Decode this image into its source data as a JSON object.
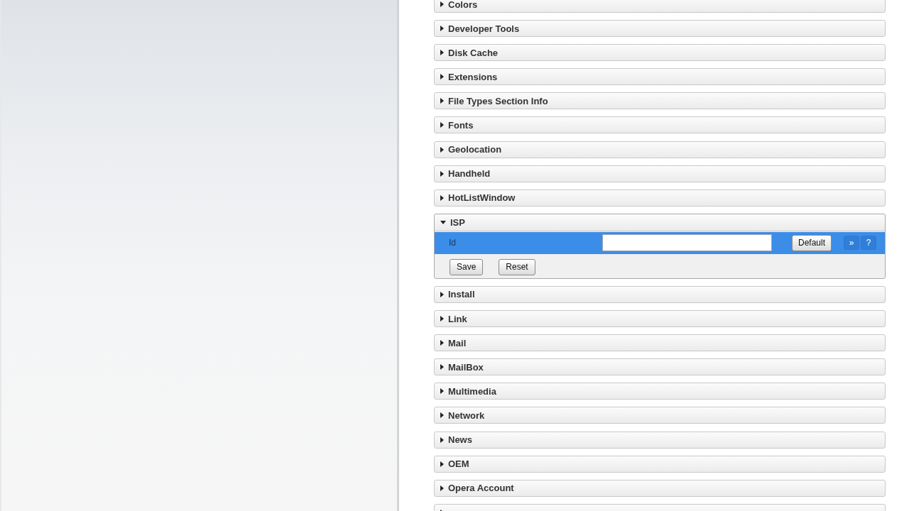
{
  "sections": [
    {
      "title": "Colors",
      "expanded": false
    },
    {
      "title": "Developer Tools",
      "expanded": false
    },
    {
      "title": "Disk Cache",
      "expanded": false
    },
    {
      "title": "Extensions",
      "expanded": false
    },
    {
      "title": "File Types Section Info",
      "expanded": false
    },
    {
      "title": "Fonts",
      "expanded": false
    },
    {
      "title": "Geolocation",
      "expanded": false
    },
    {
      "title": "Handheld",
      "expanded": false
    },
    {
      "title": "HotListWindow",
      "expanded": false
    },
    {
      "title": "ISP",
      "expanded": true,
      "settings": [
        {
          "label": "Id",
          "selected": true,
          "default_button": "Default",
          "actions": [
            "»",
            "?"
          ]
        }
      ],
      "buttons": [
        "Save",
        "Reset"
      ]
    },
    {
      "title": "Install",
      "expanded": false
    },
    {
      "title": "Link",
      "expanded": false
    },
    {
      "title": "Mail",
      "expanded": false
    },
    {
      "title": "MailBox",
      "expanded": false
    },
    {
      "title": "Multimedia",
      "expanded": false
    },
    {
      "title": "Network",
      "expanded": false
    },
    {
      "title": "News",
      "expanded": false
    },
    {
      "title": "OEM",
      "expanded": false
    },
    {
      "title": "Opera Account",
      "expanded": false
    },
    {
      "expanded": false
    }
  ]
}
